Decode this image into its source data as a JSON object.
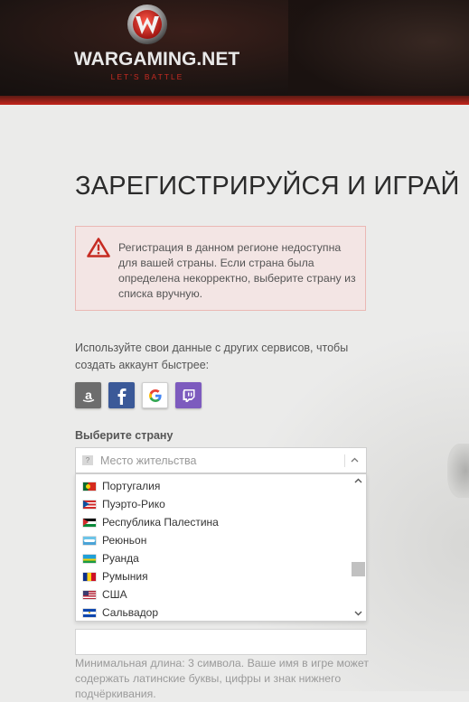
{
  "brand": {
    "name": "WARGAMING.NET",
    "tagline": "LET'S BATTLE",
    "accent_color": "#c62b22"
  },
  "page": {
    "title": "ЗАРЕГИСТРИРУЙСЯ И ИГРАЙ"
  },
  "alert": {
    "icon": "warning-triangle-icon",
    "text": "Регистрация в данном регионе недоступна для вашей страны. Если страна была определена некорректно, выберите страну из списка вручную."
  },
  "social": {
    "prompt": "Используйте свои данные с других сервисов, чтобы создать аккаунт быстрее:",
    "providers": [
      "amazon",
      "facebook",
      "google",
      "twitch"
    ]
  },
  "country": {
    "label": "Выберите страну",
    "placeholder": "Место жительства",
    "options": [
      {
        "label": "Португалия",
        "flag": "portugal-flag-icon"
      },
      {
        "label": "Пуэрто-Рико",
        "flag": "puerto-rico-flag-icon"
      },
      {
        "label": "Республика Палестина",
        "flag": "palestine-flag-icon"
      },
      {
        "label": "Реюньон",
        "flag": "reunion-flag-icon"
      },
      {
        "label": "Руанда",
        "flag": "rwanda-flag-icon"
      },
      {
        "label": "Румыния",
        "flag": "romania-flag-icon"
      },
      {
        "label": "США",
        "flag": "usa-flag-icon"
      },
      {
        "label": "Сальвадор",
        "flag": "el-salvador-flag-icon"
      }
    ]
  },
  "name_field": {
    "value": "",
    "hint": "Минимальная длина: 3 символа. Ваше имя в игре может содержать латинские буквы, цифры и знак нижнего подчёркивания."
  }
}
